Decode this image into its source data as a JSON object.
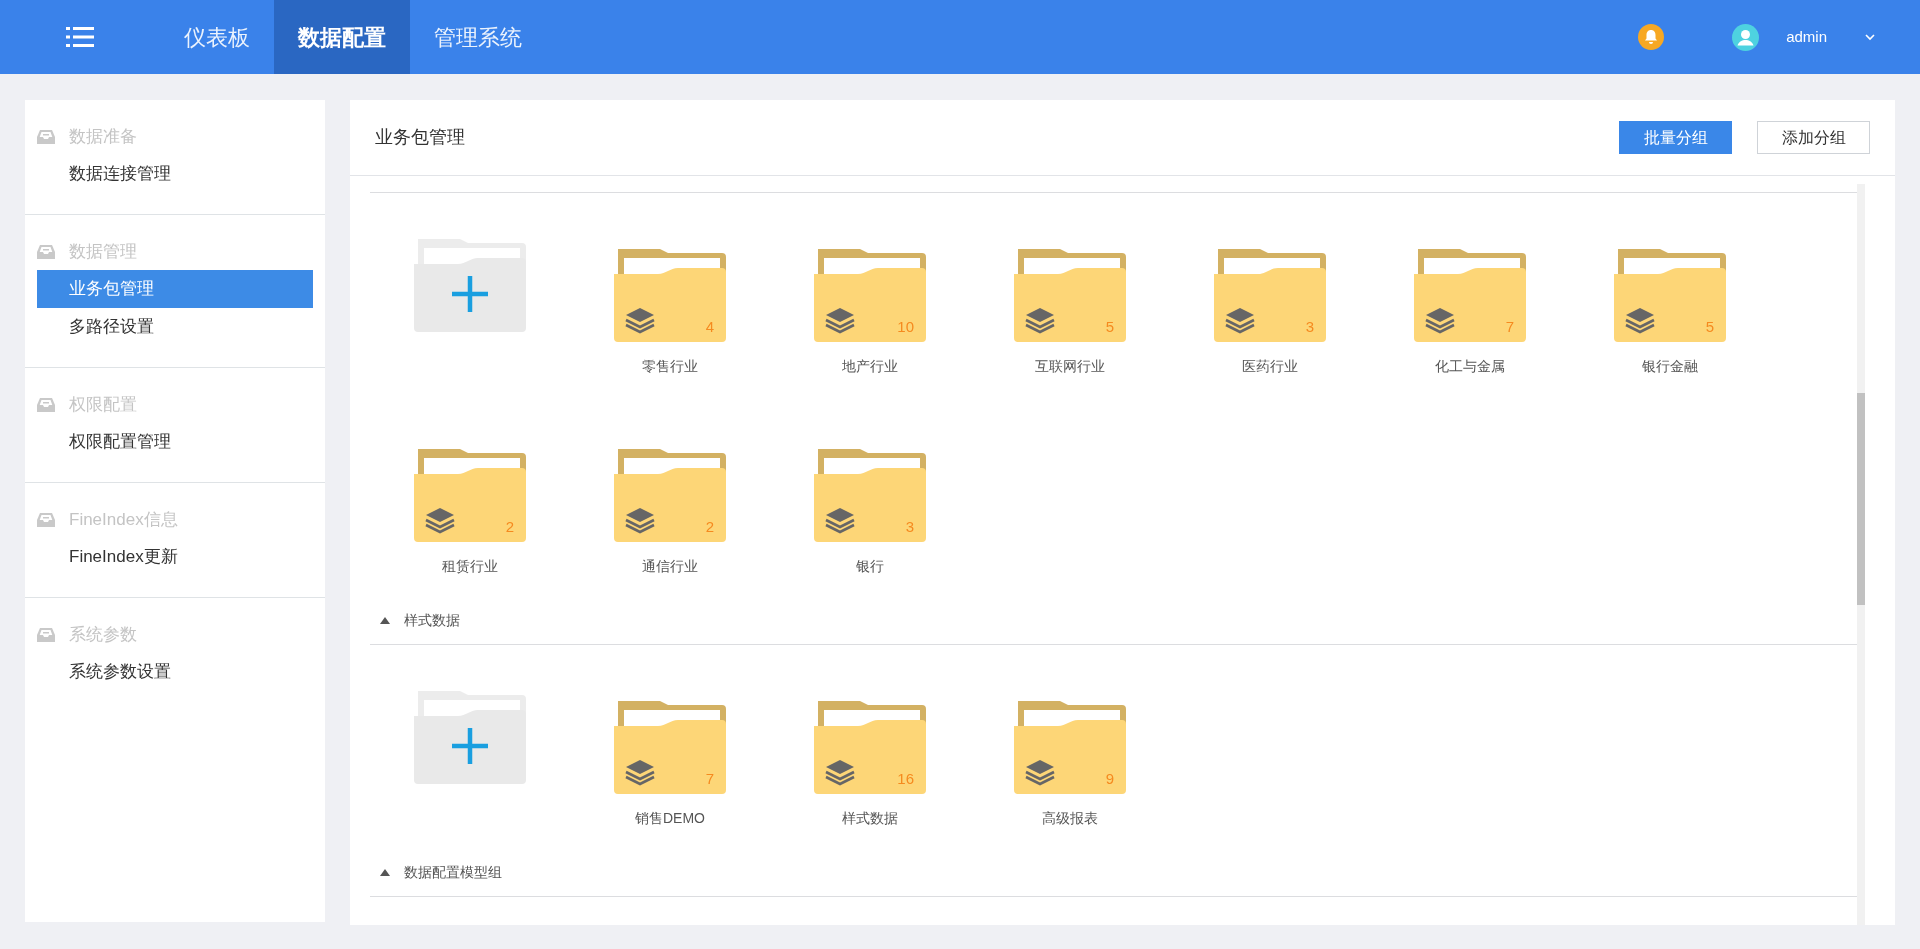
{
  "nav": {
    "tabs": [
      {
        "label": "仪表板",
        "selected": false
      },
      {
        "label": "数据配置",
        "selected": true
      },
      {
        "label": "管理系统",
        "selected": false
      }
    ],
    "user": "admin"
  },
  "sidebar": {
    "groups": [
      {
        "title": "数据准备",
        "items": [
          {
            "label": "数据连接管理",
            "selected": false
          }
        ]
      },
      {
        "title": "数据管理",
        "items": [
          {
            "label": "业务包管理",
            "selected": true
          },
          {
            "label": "多路径设置",
            "selected": false
          }
        ]
      },
      {
        "title": "权限配置",
        "items": [
          {
            "label": "权限配置管理",
            "selected": false
          }
        ]
      },
      {
        "title": "FineIndex信息",
        "items": [
          {
            "label": "FineIndex更新",
            "selected": false
          }
        ]
      },
      {
        "title": "系统参数",
        "items": [
          {
            "label": "系统参数设置",
            "selected": false
          }
        ]
      }
    ]
  },
  "main": {
    "title": "业务包管理",
    "buttons": [
      {
        "label": "批量分组",
        "kind": "primary"
      },
      {
        "label": "添加分组",
        "kind": "default"
      }
    ],
    "sections": [
      {
        "folders": [
          {
            "name": "零售行业",
            "count": "4"
          },
          {
            "name": "地产行业",
            "count": "10"
          },
          {
            "name": "互联网行业",
            "count": "5"
          },
          {
            "name": "医药行业",
            "count": "3"
          },
          {
            "name": "化工与金属",
            "count": "7"
          },
          {
            "name": "银行金融",
            "count": "5"
          },
          {
            "name": "租赁行业",
            "count": "2"
          },
          {
            "name": "通信行业",
            "count": "2"
          },
          {
            "name": "银行",
            "count": "3"
          }
        ]
      },
      {
        "title": "样式数据",
        "expanded": true,
        "folders": [
          {
            "name": "销售DEMO",
            "count": "7"
          },
          {
            "name": "样式数据",
            "count": "16"
          },
          {
            "name": "高级报表",
            "count": "9"
          }
        ]
      },
      {
        "title": "数据配置模型组",
        "expanded": true
      }
    ]
  }
}
